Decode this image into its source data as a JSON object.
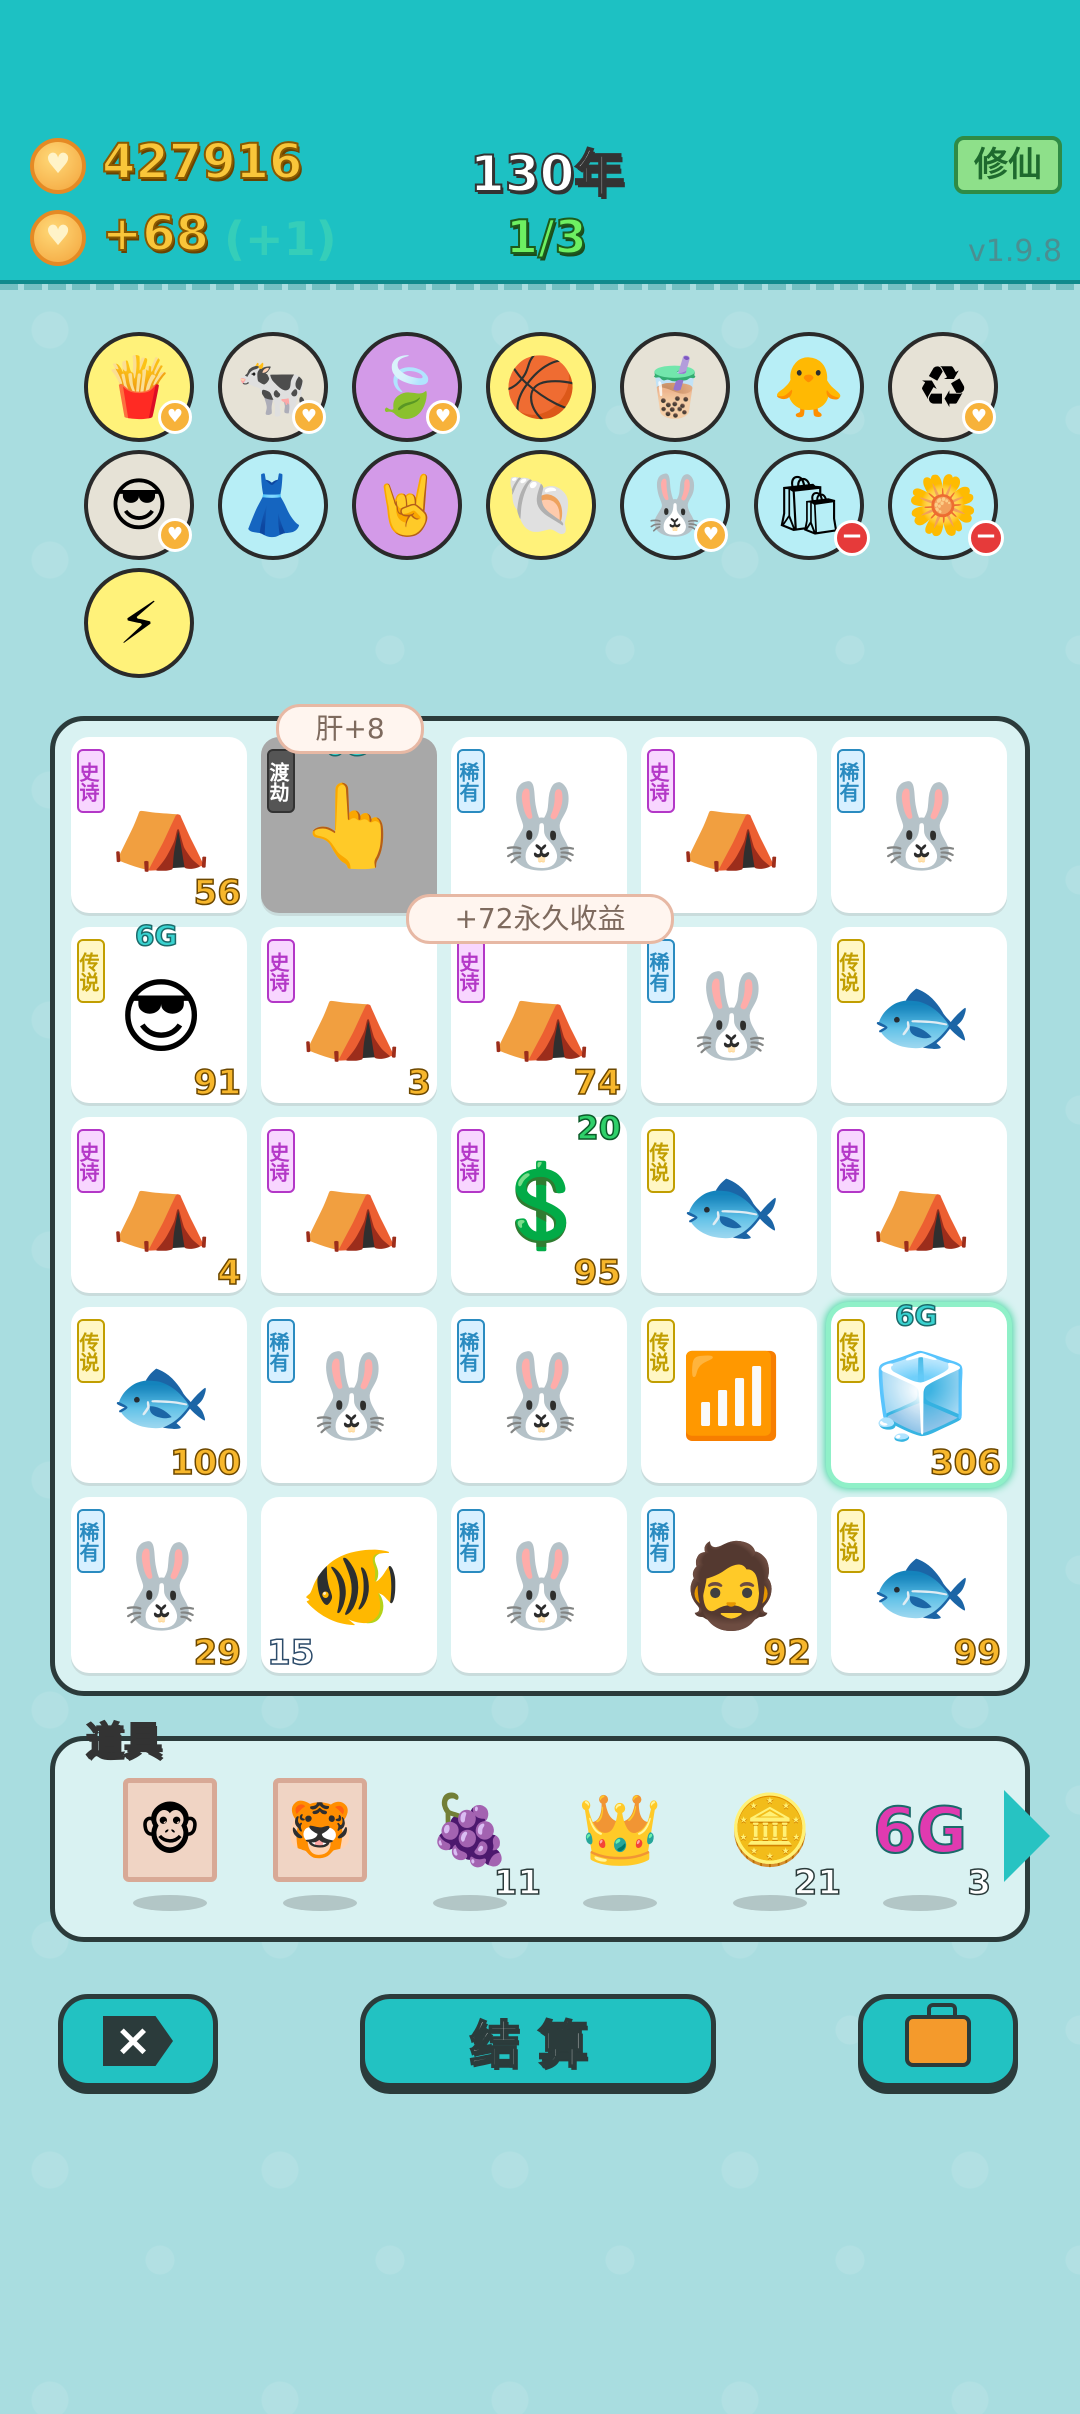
{
  "header": {
    "coins": "427916",
    "income": "+68",
    "income_bonus": "(+1)",
    "year": "130年",
    "stage": "1/3",
    "xiuxian_label": "修仙",
    "version": "v1.9.8"
  },
  "skills": [
    {
      "icon": "french-fries-icon",
      "glyph": "🍟",
      "bg": "c-yellow",
      "heart": true
    },
    {
      "icon": "cow-pair-icon",
      "glyph": "🐄",
      "bg": "c-gray",
      "heart": true
    },
    {
      "icon": "leaf-icon",
      "glyph": "🍃",
      "bg": "c-purple",
      "heart": true
    },
    {
      "icon": "basketballs-icon",
      "glyph": "🏀",
      "bg": "c-yellow",
      "heart": false
    },
    {
      "icon": "bubble-tea-icon",
      "glyph": "🧋",
      "bg": "c-gray",
      "heart": false
    },
    {
      "icon": "chick-egg-icon",
      "glyph": "🐥",
      "bg": "c-blue",
      "heart": false
    },
    {
      "icon": "recycle-icon",
      "glyph": "♻",
      "bg": "c-gray",
      "heart": true
    },
    {
      "icon": "sunglasses-cat-icon",
      "glyph": "😎",
      "bg": "c-gray",
      "heart": true
    },
    {
      "icon": "pleated-skirt-icon",
      "glyph": "👗",
      "bg": "c-blue",
      "heart": false
    },
    {
      "icon": "rock-hand-icon",
      "glyph": "🤘",
      "bg": "c-purple",
      "heart": false
    },
    {
      "icon": "shell-icon",
      "glyph": "🐚",
      "bg": "c-yellow",
      "heart": false
    },
    {
      "icon": "rabbit-icon",
      "glyph": "🐰",
      "bg": "c-blue",
      "heart": true
    },
    {
      "icon": "trash-bag-icon",
      "glyph": "🛍",
      "bg": "c-blue",
      "minus": true
    },
    {
      "icon": "flower-pot-icon",
      "glyph": "🌼",
      "bg": "c-blue",
      "minus": true
    },
    {
      "icon": "lightning-icon",
      "glyph": "⚡",
      "bg": "c-yellow",
      "heart": false
    }
  ],
  "bubbles": {
    "top": "肝+8",
    "middle": "+72永久收益"
  },
  "tiles": [
    {
      "icon": "rabbit-tent-icon",
      "glyph": "⛺",
      "tag": "史诗",
      "tagClass": "shi",
      "num": "56"
    },
    {
      "icon": "pointing-hand-icon",
      "glyph": "👆",
      "tag": "渡劫",
      "tagClass": "du",
      "dark": true,
      "badge": "6G"
    },
    {
      "icon": "rabbit-icon",
      "glyph": "🐰",
      "tag": "稀有",
      "tagClass": "xi"
    },
    {
      "icon": "rabbit-tent-icon",
      "glyph": "⛺",
      "tag": "史诗",
      "tagClass": "shi"
    },
    {
      "icon": "rabbit-icon",
      "glyph": "🐰",
      "tag": "稀有",
      "tagClass": "xi"
    },
    {
      "icon": "psy-face-icon",
      "glyph": "😎",
      "tag": "传说",
      "tagClass": "chuan",
      "num": "91",
      "badge": "6G"
    },
    {
      "icon": "rabbit-tent-icon",
      "glyph": "⛺",
      "tag": "史诗",
      "tagClass": "shi",
      "num": "3"
    },
    {
      "icon": "rabbit-tent-icon",
      "glyph": "⛺",
      "tag": "史诗",
      "tagClass": "shi",
      "num": "74"
    },
    {
      "icon": "rabbit-icon",
      "glyph": "🐰",
      "tag": "稀有",
      "tagClass": "xi"
    },
    {
      "icon": "koi-fish-icon",
      "glyph": "🐟",
      "tag": "传说",
      "tagClass": "chuan"
    },
    {
      "icon": "rabbit-tent-icon",
      "glyph": "⛺",
      "tag": "史诗",
      "tagClass": "shi",
      "num": "4"
    },
    {
      "icon": "rabbit-tent-icon",
      "glyph": "⛺",
      "tag": "史诗",
      "tagClass": "shi"
    },
    {
      "icon": "dollar-coin-icon",
      "glyph": "💲",
      "tag": "史诗",
      "tagClass": "shi",
      "num": "95",
      "greenBadge": "20"
    },
    {
      "icon": "koi-fish-icon",
      "glyph": "🐟",
      "tag": "传说",
      "tagClass": "chuan"
    },
    {
      "icon": "rabbit-tent-icon",
      "glyph": "⛺",
      "tag": "史诗",
      "tagClass": "shi"
    },
    {
      "icon": "koi-fish-icon",
      "glyph": "🐟",
      "tag": "传说",
      "tagClass": "chuan",
      "num": "100"
    },
    {
      "icon": "rabbit-icon",
      "glyph": "🐰",
      "tag": "稀有",
      "tagClass": "xi"
    },
    {
      "icon": "rabbit-icon",
      "glyph": "🐰",
      "tag": "稀有",
      "tagClass": "xi"
    },
    {
      "icon": "wifi-icon",
      "glyph": "📶",
      "tag": "传说",
      "tagClass": "chuan"
    },
    {
      "icon": "fridge-icon",
      "glyph": "🧊",
      "tag": "传说",
      "tagClass": "chuan",
      "num": "306",
      "badge": "6G",
      "glow": true
    },
    {
      "icon": "rabbit-icon",
      "glyph": "🐰",
      "tag": "稀有",
      "tagClass": "xi",
      "num": "29"
    },
    {
      "icon": "goldfish-icon",
      "glyph": "🐠",
      "numLeft": "15"
    },
    {
      "icon": "rabbit-icon",
      "glyph": "🐰",
      "tag": "稀有",
      "tagClass": "xi"
    },
    {
      "icon": "bucket-hat-man-icon",
      "glyph": "🧔",
      "tag": "稀有",
      "tagClass": "xi",
      "num": "92"
    },
    {
      "icon": "koi-fish-icon",
      "glyph": "🐟",
      "tag": "传说",
      "tagClass": "chuan",
      "num": "99"
    }
  ],
  "items": {
    "title": "道具",
    "list": [
      {
        "icon": "monkey-portrait-icon",
        "glyph": "🐵",
        "frame": true
      },
      {
        "icon": "tiger-portrait-icon",
        "glyph": "🐯",
        "frame": true
      },
      {
        "icon": "lychee-icon",
        "glyph": "🍇",
        "count": "11"
      },
      {
        "icon": "crown-icon",
        "glyph": "👑"
      },
      {
        "icon": "gold-coin-icon",
        "glyph": "🪙",
        "count": "21"
      },
      {
        "icon": "6g-icon",
        "glyph": "6G",
        "count": "3"
      }
    ]
  },
  "buttons": {
    "settle": "结算"
  }
}
